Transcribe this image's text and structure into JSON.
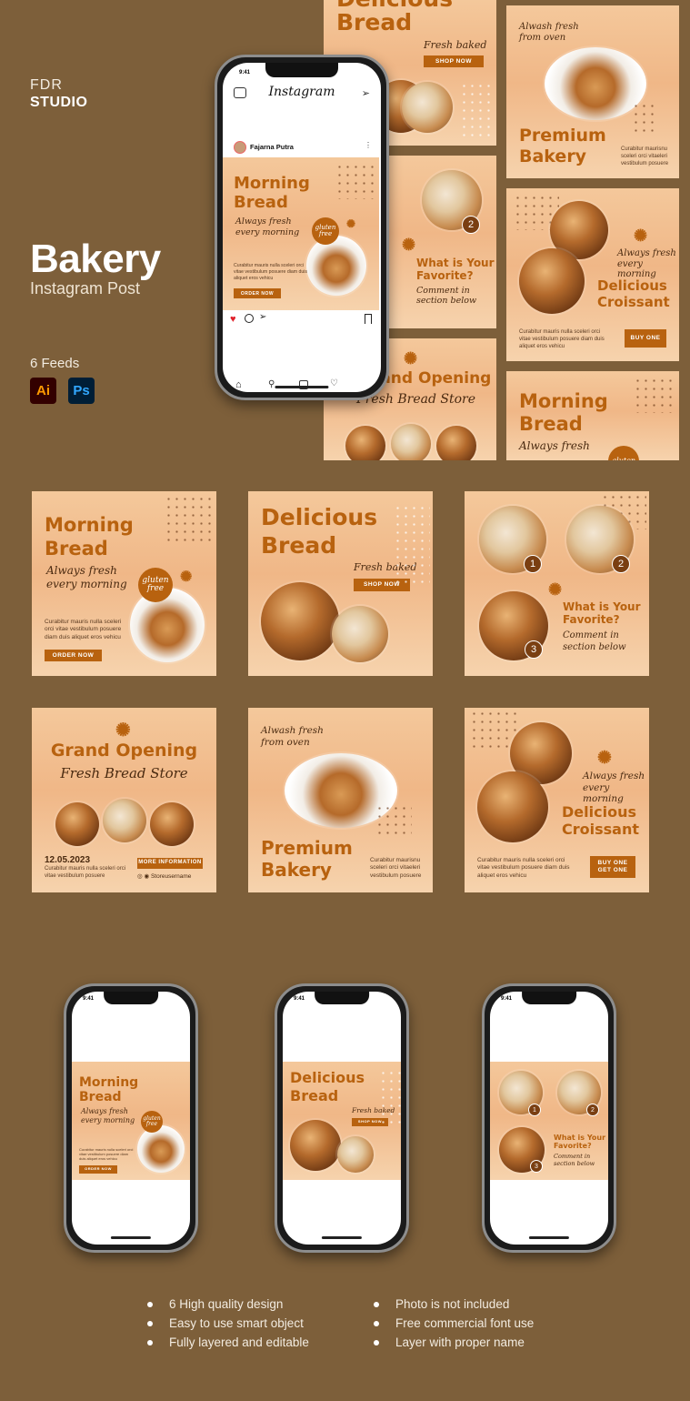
{
  "brand": {
    "line1": "FDR",
    "line2": "STUDIO"
  },
  "title": "Bakery",
  "subtitle": "Instagram Post",
  "feeds_count": "6 Feeds",
  "apps": [
    {
      "label": "Ai",
      "icon": "illustrator-icon"
    },
    {
      "label": "Ps",
      "icon": "photoshop-icon"
    }
  ],
  "instagram": {
    "logo": "Instagram",
    "time": "9:41",
    "username": "Fajarna Putra"
  },
  "posts": {
    "morning": {
      "title1": "Morning",
      "title2": "Bread",
      "tag1": "Always fresh",
      "tag2": "every morning",
      "badge1": "gluten",
      "badge2": "free",
      "body": "Curabitur mauris nulla sceleri orci vitae vestibulum posuere diam duis aliquet eros vehicu",
      "button": "ORDER NOW"
    },
    "delicious": {
      "title1": "Delicious",
      "title2": "Bread",
      "tag": "Fresh baked",
      "button": "SHOP NOW"
    },
    "favorite": {
      "q1": "What is Your",
      "q2": "Favorite?",
      "c1": "Comment in",
      "c2": "section below",
      "n1": "1",
      "n2": "2",
      "n3": "3"
    },
    "opening": {
      "title": "Grand Opening",
      "tag": "Fresh Bread Store",
      "date": "12.05.2023",
      "body": "Curabitur mauris nulla sceleri orci vitae vestibulum posuere",
      "button": "MORE INFORMATION",
      "handle": "Storeusername"
    },
    "premium": {
      "tag1": "Alwash fresh",
      "tag2": "from oven",
      "title1": "Premium",
      "title2": "Bakery",
      "body": "Curabitur maurisnu sceleri orci vitaeleri vestibulum posuere"
    },
    "croissant": {
      "tag1": "Always fresh",
      "tag2": "every morning",
      "title1": "Delicious",
      "title2": "Croissant",
      "body": "Curabitur mauris nulla sceleri orci vitae vestibulum posuere diam duis aliquet eros vehicu",
      "button1": "BUY ONE",
      "button2": "GET ONE"
    }
  },
  "features_left": [
    "6 High quality design",
    "Easy to use smart object",
    "Fully layered and editable"
  ],
  "features_right": [
    "Photo is not included",
    "Free commercial font use",
    "Layer with proper name"
  ],
  "colors": {
    "background": "#7d5f3a",
    "accent": "#b8620f",
    "dark_text": "#4a2a10"
  }
}
